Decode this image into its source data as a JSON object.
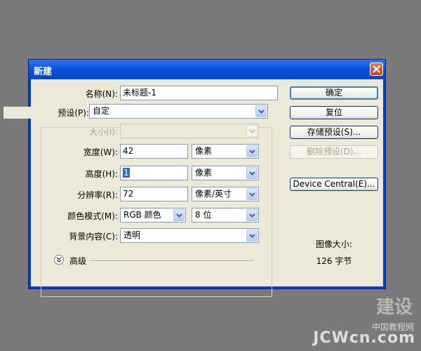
{
  "dialog": {
    "title": "新建",
    "name_label": "名称(N):",
    "name_value": "未标题-1",
    "preset_label": "预设(P):",
    "preset_value": "自定",
    "size_label": "大小(I):",
    "size_value": "",
    "width_label": "宽度(W):",
    "width_value": "42",
    "width_unit": "像素",
    "height_label": "高度(H):",
    "height_value": "1",
    "height_unit": "像素",
    "resolution_label": "分辨率(R):",
    "resolution_value": "72",
    "resolution_unit": "像素/英寸",
    "color_mode_label": "颜色模式(M):",
    "color_mode_value": "RGB 颜色",
    "bit_depth_value": "8 位",
    "background_label": "背景内容(C):",
    "background_value": "透明",
    "advanced_label": "高级",
    "buttons": {
      "ok": "确定",
      "reset": "复位",
      "save_preset": "存储预设(S)...",
      "delete_preset": "删除预设(D)...",
      "device_central": "Device Central(E)..."
    },
    "image_size_label": "图像大小:",
    "image_size_value": "126 字节"
  },
  "watermark": {
    "text": "JCWcn.com",
    "sub_text": "中国教程网",
    "logo_text": "建设"
  },
  "colors": {
    "desktop": "#7a7a7a",
    "titlebar": "#0a50d8",
    "dialog_bg": "#ece9d8",
    "selection": "#316ac5"
  }
}
